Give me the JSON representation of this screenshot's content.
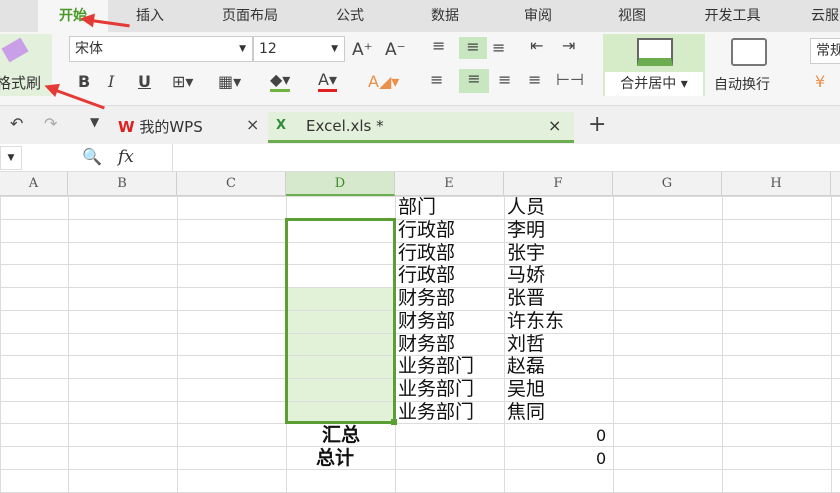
{
  "tabs": [
    "开始",
    "插入",
    "页面布局",
    "公式",
    "数据",
    "审阅",
    "视图",
    "开发工具",
    "云服"
  ],
  "ribbon": {
    "format_painter": "格式刷",
    "font_name": "宋体",
    "font_size": "12",
    "bold": "B",
    "italic": "I",
    "underline": "U",
    "merge_center": "合并居中",
    "wrap_text": "自动换行",
    "number_format": "常规"
  },
  "doc_tabs": {
    "wps": "我的WPS",
    "file": "Excel.xls *"
  },
  "formula_bar": {
    "fx": "fx",
    "value": ""
  },
  "columns": [
    "A",
    "B",
    "C",
    "D",
    "E",
    "F",
    "G",
    "H"
  ],
  "cells": {
    "e": [
      "部门",
      "行政部",
      "行政部",
      "行政部",
      "财务部",
      "财务部",
      "财务部",
      "业务部门",
      "业务部门",
      "业务部门"
    ],
    "f": [
      "人员",
      "李明",
      "张宇",
      "马娇",
      "张晋",
      "许东东",
      "刘哲",
      "赵磊",
      "吴旭",
      "焦同"
    ],
    "summary_label": "汇总",
    "total_label": "总计",
    "summary_value": "0",
    "total_value": "0"
  },
  "colors": {
    "accent": "#6cad4f",
    "selection": "#e2f2d8"
  }
}
